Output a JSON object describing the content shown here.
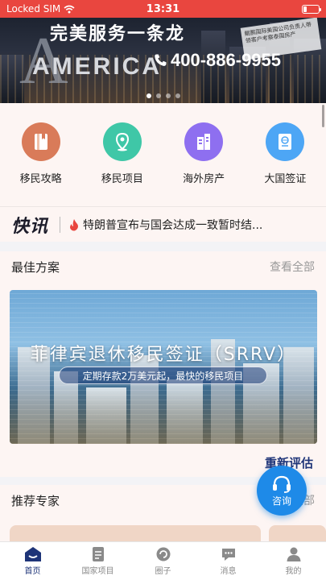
{
  "status_bar": {
    "carrier": "Locked SIM",
    "time": "13:31"
  },
  "banner": {
    "slogan": "完美服务一条龙",
    "headline": "AMERICA",
    "phone": "400-886-9955",
    "tag": "鲲鹏国际美国公司负责人带领客户考察泰国房产",
    "slides": 4,
    "active_slide": 1
  },
  "quick_menu": [
    {
      "label": "移民攻略",
      "icon": "guide-book-icon",
      "color": "#d97b59"
    },
    {
      "label": "移民项目",
      "icon": "location-pin-icon",
      "color": "#3fc7a7"
    },
    {
      "label": "海外房产",
      "icon": "buildings-icon",
      "color": "#8e6ff0"
    },
    {
      "label": "大国签证",
      "icon": "passport-icon",
      "color": "#4da6f5"
    }
  ],
  "news": {
    "logo": "快讯",
    "headline": "特朗普宣布与国会达成一致暂时结..."
  },
  "best_plan": {
    "title": "最佳方案",
    "more": "查看全部",
    "card_title": "菲律宾退休移民签证（SRRV）",
    "card_subtitle": "定期存款2万美元起，最快的移民项目",
    "reassess": "重新评估"
  },
  "experts": {
    "title": "推荐专家",
    "more": "查看全部"
  },
  "consult_button": {
    "label": "咨询"
  },
  "tab_bar": [
    {
      "label": "首页",
      "icon": "home-icon",
      "active": true
    },
    {
      "label": "国家项目",
      "icon": "document-icon",
      "active": false
    },
    {
      "label": "圈子",
      "icon": "circle-icon",
      "active": false
    },
    {
      "label": "消息",
      "icon": "message-icon",
      "active": false
    },
    {
      "label": "我的",
      "icon": "person-icon",
      "active": false
    }
  ],
  "colors": {
    "status_bar": "#e9463f",
    "accent": "#1e3478",
    "consult": "#1e8ae8",
    "background": "#fdf5f3"
  }
}
